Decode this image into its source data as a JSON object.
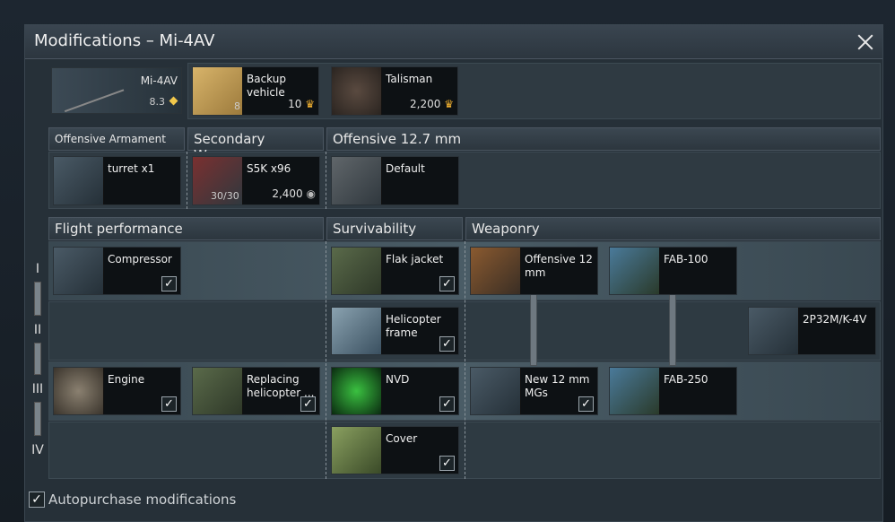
{
  "window": {
    "title": "Modifications – Mi-4AV"
  },
  "vehicle": {
    "name": "Mi-4AV",
    "br": "8.3"
  },
  "backup": {
    "name": "Backup vehicle",
    "count": "8",
    "price": "10"
  },
  "talisman": {
    "name": "Talisman",
    "price": "2,200"
  },
  "weapon_headers": {
    "offensive": "Offensive Armament",
    "secondary": "Secondary Weapons",
    "offensive127": "Offensive 12.7 mm"
  },
  "weapons": {
    "turret": {
      "name": "turret x1"
    },
    "s5k": {
      "name": "S5K x96",
      "ammo": "30/30",
      "price": "2,400"
    },
    "default": {
      "name": "Default"
    }
  },
  "sections": {
    "flight": "Flight performance",
    "survivability": "Survivability",
    "weaponry": "Weaponry"
  },
  "tiers": [
    "I",
    "II",
    "III",
    "IV"
  ],
  "mods": {
    "compressor": "Compressor",
    "flak_jacket": "Flak jacket",
    "offensive12": "Offensive 12 mm",
    "fab100": "FAB-100",
    "heli_frame": "Helicopter frame",
    "p2p32": "2P32M/K-4V",
    "engine": "Engine",
    "replacing": "Replacing helicopter ...",
    "nvd": "NVD",
    "new12": "New 12 mm MGs",
    "fab250": "FAB-250",
    "cover": "Cover"
  },
  "footer": {
    "autopurchase": "Autopurchase modifications",
    "checked": "✓"
  }
}
